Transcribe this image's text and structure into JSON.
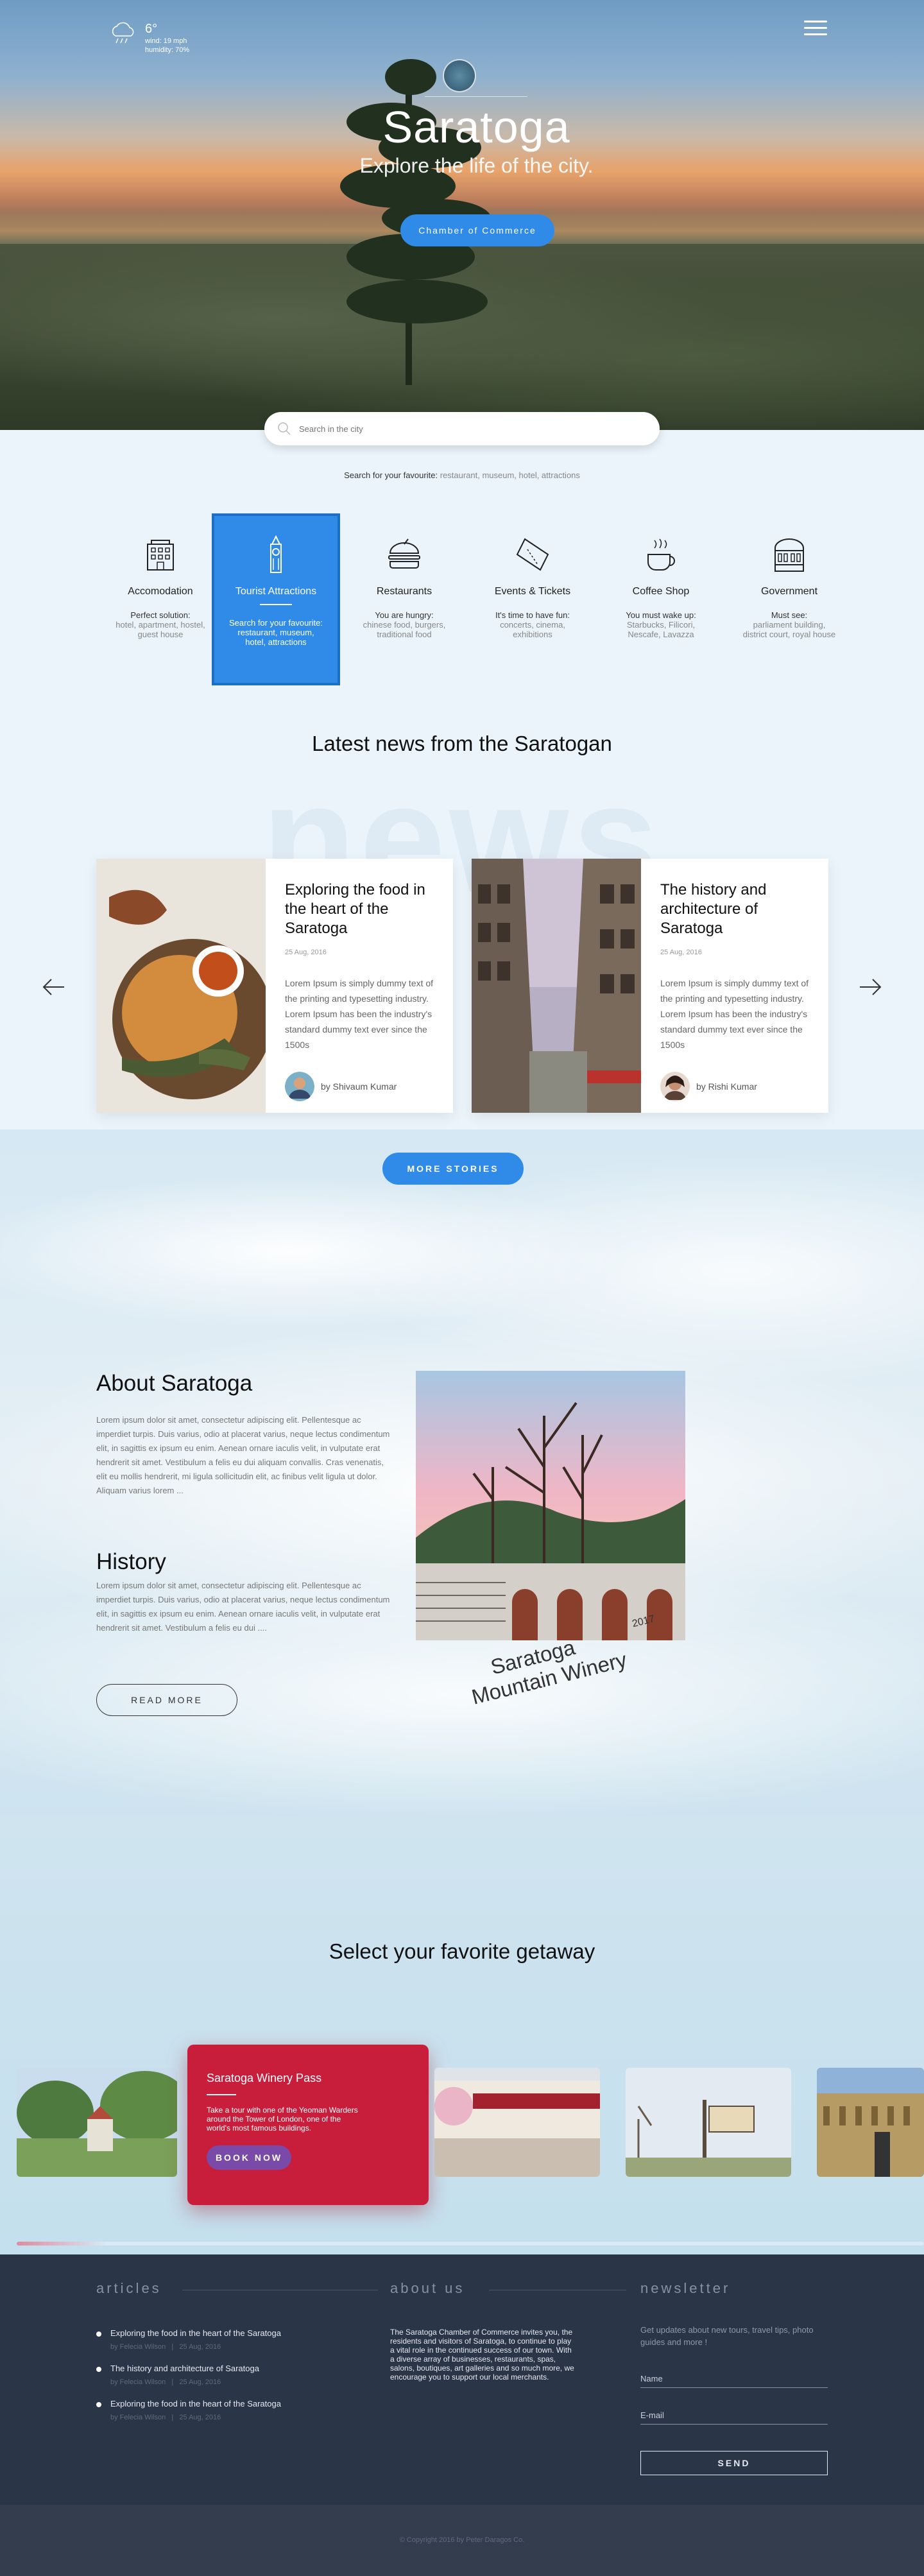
{
  "weather": {
    "icon": "cloud-rain-icon",
    "temp": "6°",
    "wind": "wind: 19 mph",
    "humidity": "humidity: 70%"
  },
  "hero": {
    "title": "Saratoga",
    "subtitle": "Explore the life of the city.",
    "button": "Chamber of Commerce"
  },
  "search": {
    "placeholder": "Search in the city",
    "hint_label": "Search for your favourite:",
    "hint_values": "restaurant, museum, hotel, attractions"
  },
  "categories": [
    {
      "name": "Accomodation",
      "line1": "Perfect solution:",
      "line2": "hotel, apartment, hostel,",
      "line3": "guest house",
      "icon": "building-icon"
    },
    {
      "name": "Tourist Attractions",
      "line1": "Search for your favourite:",
      "line2": "restaurant, museum,",
      "line3": "hotel, attractions",
      "icon": "big-ben-icon"
    },
    {
      "name": "Restaurants",
      "line1": "You are hungry:",
      "line2": "chinese food, burgers,",
      "line3": "traditional food",
      "icon": "burger-icon"
    },
    {
      "name": "Events & Tickets",
      "line1": "It's time to have fun:",
      "line2": "concerts, cinema,",
      "line3": "exhibitions",
      "icon": "ticket-icon"
    },
    {
      "name": "Coffee Shop",
      "line1": "You must wake up:",
      "line2": "Starbucks, Filicori,",
      "line3": "Nescafe, Lavazza",
      "icon": "coffee-cup-icon"
    },
    {
      "name": "Government",
      "line1": "Must see:",
      "line2": "parliament building,",
      "line3": "district court, royal house",
      "icon": "government-building-icon"
    }
  ],
  "news": {
    "title": "Latest news from the Saratogan",
    "bg_word": "news",
    "more_button": "MORE STORIES",
    "cards": [
      {
        "title": "Exploring the food in the heart of the Saratoga",
        "date": "25 Aug, 2016",
        "text": "Lorem Ipsum is simply dummy text of the printing and typesetting industry. Lorem Ipsum has been the industry's standard dummy text ever since the 1500s",
        "author": "by Shivaum Kumar"
      },
      {
        "title": "The history and architecture of Saratoga",
        "date": "25 Aug, 2016",
        "text": "Lorem Ipsum is simply dummy text of the printing and typesetting industry. Lorem Ipsum has been the industry's standard dummy text ever since the 1500s",
        "author": "by Rishi  Kumar"
      }
    ]
  },
  "about": {
    "title": "About Saratoga",
    "text": "Lorem ipsum dolor sit amet, consectetur adipiscing elit. Pellentesque ac imperdiet turpis. Duis varius, odio at placerat varius, neque lectus condimentum elit, in sagittis ex ipsum eu enim. Aenean ornare iaculis velit, in vulputate erat hendrerit sit amet. Vestibulum a felis eu dui aliquam convallis. Cras venenatis, elit eu mollis hendrerit, mi ligula sollicitudin elit, ac finibus velit ligula ut dolor. Aliquam varius lorem ...",
    "history_title": "History",
    "history_text": "Lorem ipsum dolor sit amet, consectetur adipiscing elit. Pellentesque ac imperdiet turpis. Duis varius, odio at placerat varius, neque lectus condimentum elit, in sagittis ex ipsum eu enim. Aenean ornare iaculis velit, in vulputate erat hendrerit sit amet. Vestibulum a felis eu dui  ....",
    "button": "READ MORE",
    "caption_l1": "Saratoga",
    "caption_l2": "Mountain Winery",
    "caption_year": "2017"
  },
  "getaway": {
    "title": "Select your favorite getaway",
    "feature_title": "Saratoga  Winery Pass",
    "feature_text": "Take a tour with one of the Yeoman Warders around the Tower of London, one of the world's most famous buildings.",
    "feature_button": "BOOK NOW",
    "progress": 0.1
  },
  "footer": {
    "articles_title": "articles",
    "about_title": "about us",
    "newsletter_title": "newsletter",
    "articles": [
      {
        "title": "Exploring the food in the heart of the Saratoga",
        "author": "by Felecia Wilson",
        "date": "25 Aug, 2016"
      },
      {
        "title": "The history and architecture of Saratoga",
        "author": "by Felecia Wilson",
        "date": "25 Aug, 2016"
      },
      {
        "title": "Exploring the food in the heart of the Saratoga",
        "author": "by Felecia Wilson",
        "date": "25 Aug, 2016"
      }
    ],
    "separator": "|",
    "about_text": "The Saratoga Chamber of Commerce invites you, the residents and visitors of Saratoga, to continue to play a vital role in the continued success of our town. With a diverse array of businesses, restaurants, spas, salons, boutiques, art galleries and so much more, we encourage you to support our local merchants.",
    "newsletter_text": "Get updates about new tours, travel tips, photo guides and more !",
    "name_placeholder": "Name",
    "email_placeholder": "E-mail",
    "send_button": "SEND",
    "copyright": "© Copyright 2016  by Peter Daragos Co."
  },
  "colors": {
    "accent": "#2f8be7",
    "feature": "#c81e3c",
    "footer": "#2b3548"
  }
}
